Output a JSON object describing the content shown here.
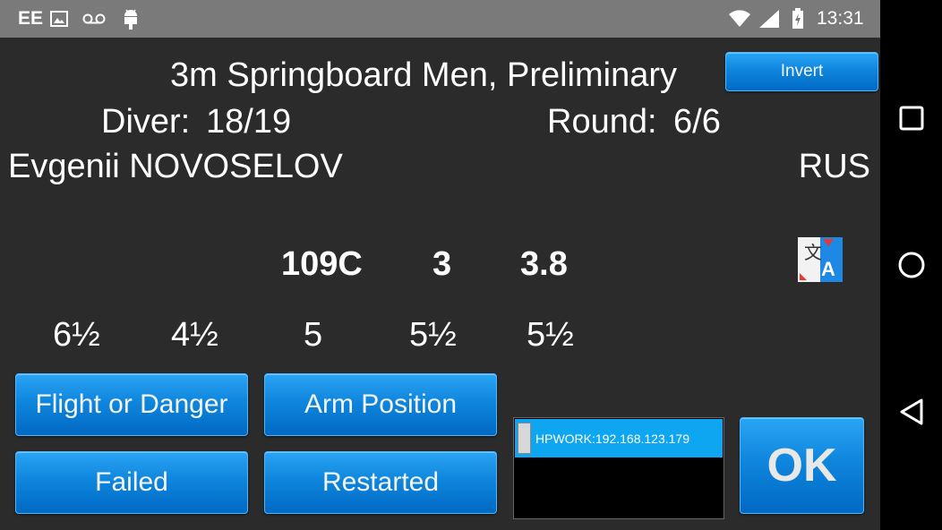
{
  "status_bar": {
    "carrier": "EE",
    "time": "13:31",
    "icons": [
      "image-icon",
      "voicemail-icon",
      "android-icon",
      "wifi-icon",
      "signal-icon",
      "battery-charging-icon"
    ]
  },
  "header": {
    "event_title": "3m Springboard Men, Preliminary",
    "invert_label": "Invert"
  },
  "diver": {
    "diver_label": "Diver:",
    "diver_value": "18/19",
    "round_label": "Round:",
    "round_value": "6/6",
    "name": "Evgenii NOVOSELOV",
    "country": "RUS"
  },
  "dive": {
    "code": "109C",
    "height": "3",
    "difficulty": "3.8"
  },
  "scores": [
    "6½",
    "4½",
    "5",
    "5½",
    "5½"
  ],
  "buttons": {
    "flight_or_danger": "Flight or Danger",
    "arm_position": "Arm Position",
    "failed": "Failed",
    "restarted": "Restarted",
    "ok": "OK"
  },
  "server_list": {
    "items": [
      "HPWORK:192.168.123.179"
    ]
  },
  "colors": {
    "accent": "#0f86dd",
    "background": "#2b2b2b",
    "list_selected": "#0ea5f1"
  }
}
